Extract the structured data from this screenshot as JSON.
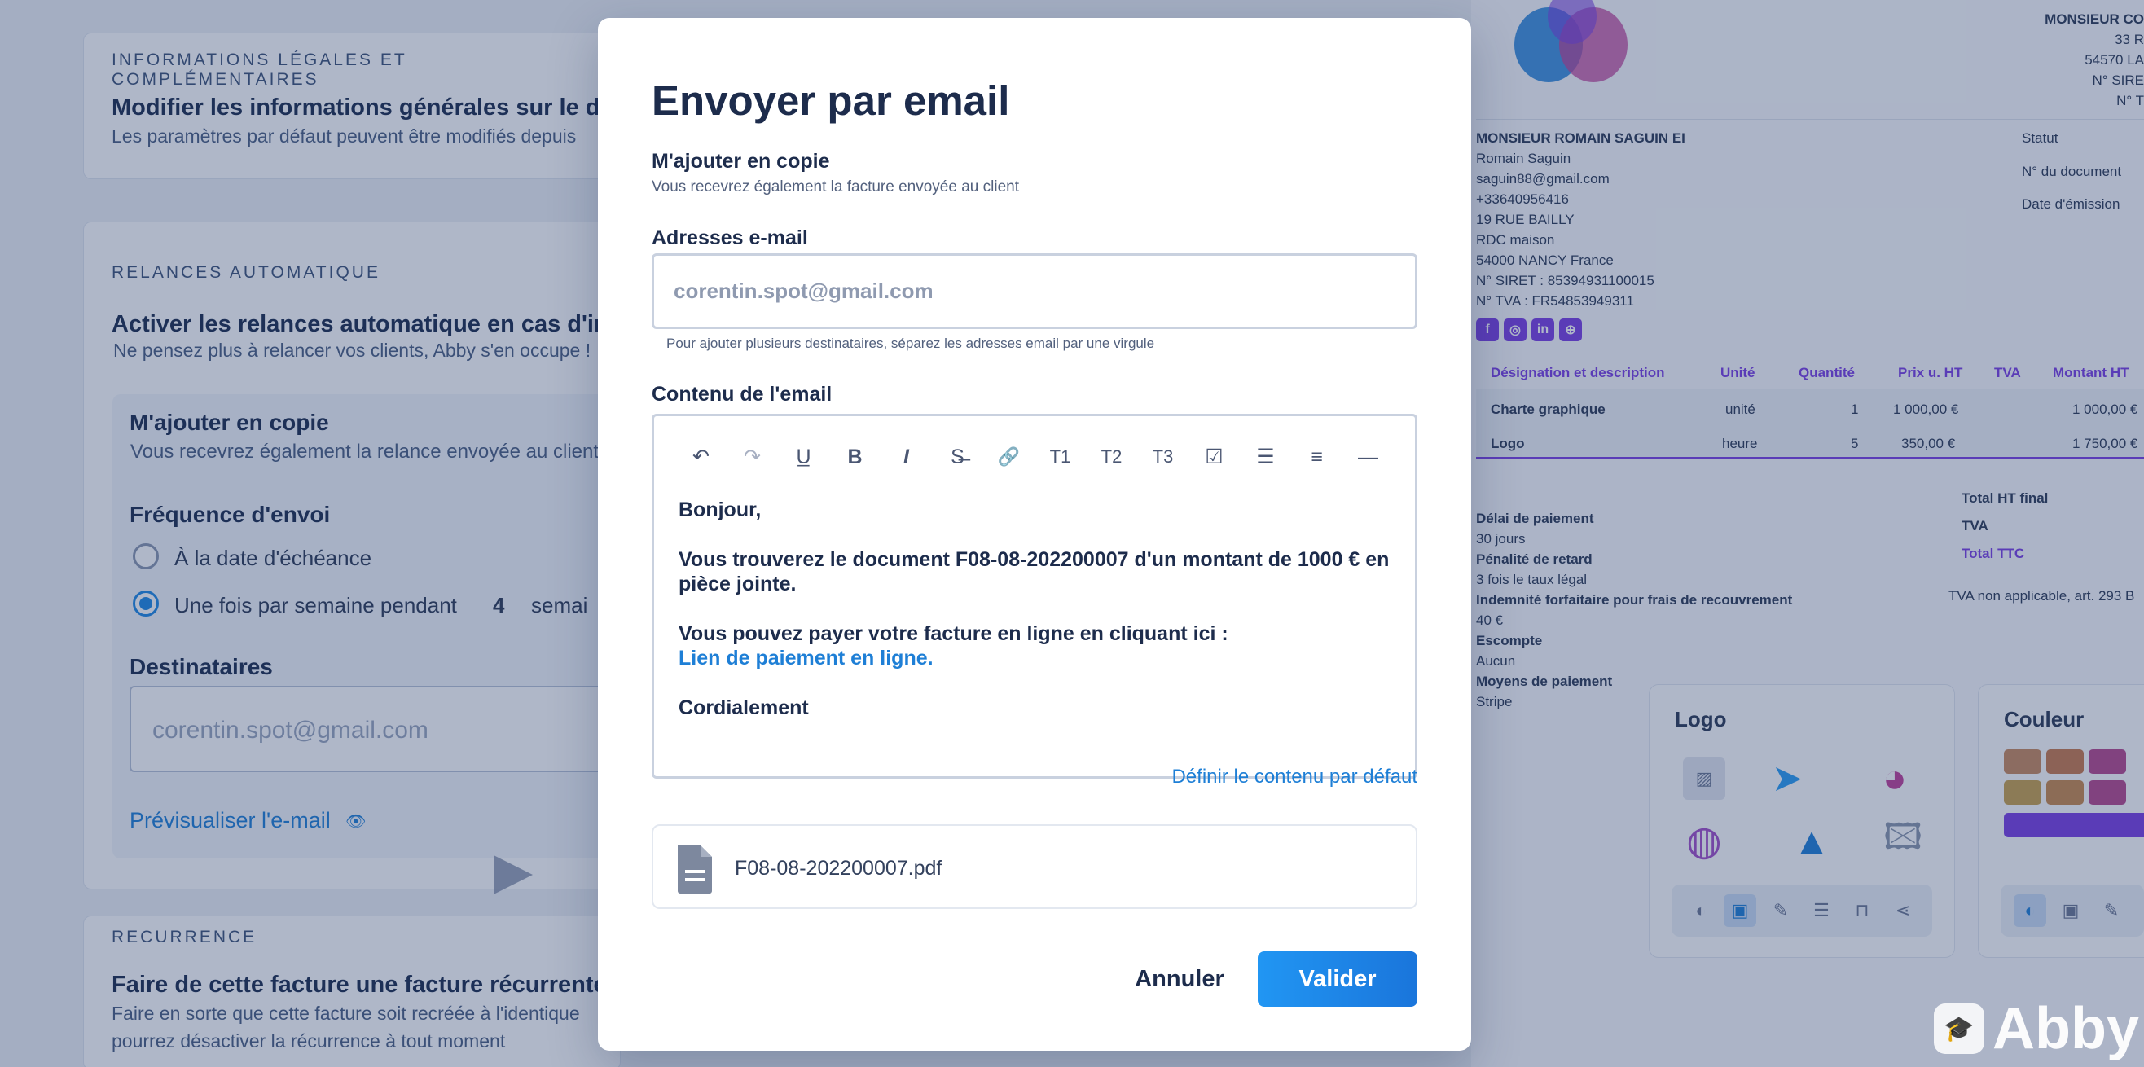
{
  "background_left": {
    "legal": {
      "tag": "INFORMATIONS LÉGALES ET COMPLÉMENTAIRES",
      "title": "Modifier les informations générales sur le do",
      "subtitle": "Les paramètres par défaut peuvent être modifiés depuis"
    },
    "reminders": {
      "tag": "RELANCES AUTOMATIQUE",
      "title": "Activer les relances automatique en cas d'im",
      "subtitle": "Ne pensez plus à relancer vos clients, Abby s'en occupe !",
      "copy_title": "M'ajouter en copie",
      "copy_subtitle": "Vous recevrez également la relance envoyée au client",
      "frequency_title": "Fréquence d'envoi",
      "option_due": "À la date d'échéance",
      "option_weekly": "Une fois par semaine pendant",
      "weekly_count": "4",
      "weekly_unit": "semai",
      "recipients_title": "Destinataires",
      "recipients_placeholder": "corentin.spot@gmail.com",
      "preview_link": "Prévisualiser l'e-mail"
    },
    "recurrence": {
      "tag": "RECURRENCE",
      "title": "Faire de cette facture une facture récurrente",
      "subtitle_1": "Faire en sorte que cette facture soit recréée à l'identique",
      "subtitle_2": "pourrez désactiver la récurrence à tout moment"
    }
  },
  "background_right": {
    "client_name": "MONSIEUR CO",
    "client_line_1": "33 R",
    "client_line_2": "54570 LA",
    "client_line_3": "N° SIRE",
    "client_line_4": "N° T",
    "issuer": {
      "name": "MONSIEUR ROMAIN SAGUIN EI",
      "lines": [
        "Romain Saguin",
        "saguin88@gmail.com",
        "+33640956416",
        "19 RUE BAILLY",
        "RDC maison",
        "54000 NANCY France",
        "N° SIRET : 85394931100015",
        "N° TVA : FR54853949311"
      ]
    },
    "meta_labels": [
      "Statut",
      "N° du document",
      "Date d'émission"
    ],
    "table": {
      "headers": [
        "Désignation et description",
        "Unité",
        "Quantité",
        "Prix u. HT",
        "TVA",
        "Montant HT"
      ],
      "rows": [
        [
          "Charte graphique",
          "unité",
          "1",
          "1 000,00 €",
          "",
          "1 000,00 €"
        ],
        [
          "Logo",
          "heure",
          "5",
          "350,00 €",
          "",
          "1 750,00 €"
        ]
      ]
    },
    "totals": [
      "Total HT final",
      "TVA",
      "Total TTC"
    ],
    "tva_note": "TVA non applicable, art. 293 B",
    "payment": [
      [
        "Délai de paiement",
        "30 jours"
      ],
      [
        "Pénalité de retard",
        "3 fois le taux légal"
      ],
      [
        "Indemnité forfaitaire pour frais de recouvrement",
        "40 €"
      ],
      [
        "Escompte",
        "Aucun"
      ],
      [
        "Moyens de paiement",
        "Stripe"
      ]
    ],
    "logo_panel_title": "Logo",
    "color_panel_title": "Couleur",
    "swatches": [
      "#c98a5e",
      "#c87a4e",
      "#b8488e",
      "#8e3db0",
      "#c9a24e",
      "#c88a4e",
      "#b8488e",
      "#7b3fe4"
    ]
  },
  "modal": {
    "title": "Envoyer par email",
    "copy_label": "M'ajouter en copie",
    "copy_hint": "Vous recevrez également la facture envoyée au client",
    "emails_label": "Adresses e-mail",
    "emails_placeholder": "corentin.spot@gmail.com",
    "emails_help": "Pour ajouter plusieurs destinataires, séparez les adresses email par une virgule",
    "content_label": "Contenu de l'email",
    "toolbar": [
      {
        "name": "undo-icon",
        "glyph": "↶",
        "dim": false
      },
      {
        "name": "redo-icon",
        "glyph": "↷",
        "dim": true
      },
      {
        "name": "underline-icon",
        "glyph": "U̲",
        "dim": false
      },
      {
        "name": "bold-icon",
        "glyph": "B",
        "dim": false
      },
      {
        "name": "italic-icon",
        "glyph": "I",
        "dim": false
      },
      {
        "name": "strikethrough-icon",
        "glyph": "S̶",
        "dim": false
      },
      {
        "name": "link-icon",
        "glyph": "🔗",
        "dim": false
      },
      {
        "name": "heading-1-icon",
        "glyph": "T1",
        "dim": false
      },
      {
        "name": "heading-2-icon",
        "glyph": "T2",
        "dim": false
      },
      {
        "name": "heading-3-icon",
        "glyph": "T3",
        "dim": false
      },
      {
        "name": "checklist-icon",
        "glyph": "☑",
        "dim": false
      },
      {
        "name": "bullet-list-icon",
        "glyph": "☰",
        "dim": false
      },
      {
        "name": "numbered-list-icon",
        "glyph": "≡",
        "dim": false
      },
      {
        "name": "horizontal-rule-icon",
        "glyph": "—",
        "dim": false
      }
    ],
    "body": {
      "greeting": "Bonjour,",
      "line_1": "Vous trouverez le document F08-08-202200007 d'un montant de 1000 € en pièce jointe.",
      "line_2": "Vous pouvez payer votre facture en ligne en cliquant ici :",
      "payment_link": "Lien de paiement en ligne.",
      "closing": "Cordialement"
    },
    "default_content_link": "Définir le contenu par défaut",
    "attachment_name": "F08-08-202200007.pdf",
    "cancel_label": "Annuler",
    "submit_label": "Valider"
  },
  "brand": {
    "watermark": "Abby",
    "accent": "#1e88e5",
    "purple": "#7b3fe4"
  }
}
